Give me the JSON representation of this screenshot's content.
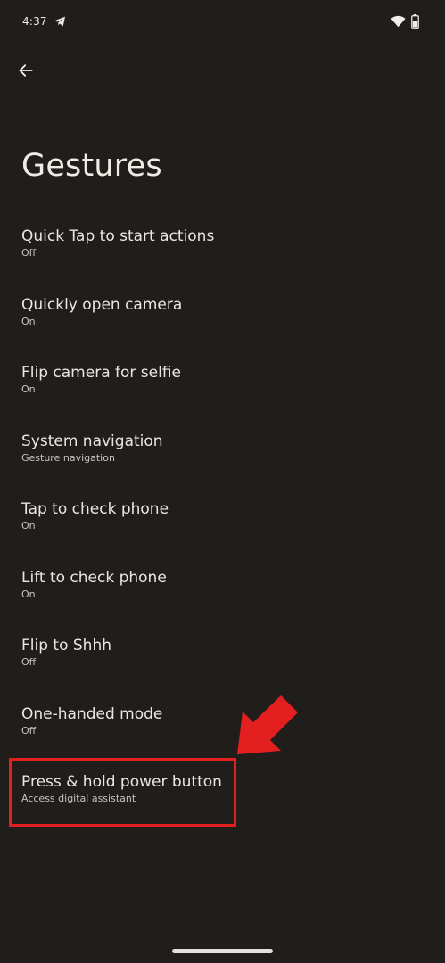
{
  "status_bar": {
    "time": "4:37",
    "icons": [
      "telegram-icon",
      "wifi-icon",
      "battery-icon"
    ]
  },
  "header": {
    "back_icon": "arrow-left-icon",
    "title": "Gestures"
  },
  "settings": [
    {
      "title": "Quick Tap to start actions",
      "summary": "Off"
    },
    {
      "title": "Quickly open camera",
      "summary": "On"
    },
    {
      "title": "Flip camera for selfie",
      "summary": "On"
    },
    {
      "title": "System navigation",
      "summary": "Gesture navigation"
    },
    {
      "title": "Tap to check phone",
      "summary": "On"
    },
    {
      "title": "Lift to check phone",
      "summary": "On"
    },
    {
      "title": "Flip to Shhh",
      "summary": "Off"
    },
    {
      "title": "One-handed mode",
      "summary": "Off"
    },
    {
      "title": "Press & hold power button",
      "summary": "Access digital assistant"
    }
  ],
  "colors": {
    "background": "#201d1b",
    "text_primary": "#ece6e1",
    "text_secondary": "#c9c2bc",
    "annotation_red": "#e41f1f"
  }
}
